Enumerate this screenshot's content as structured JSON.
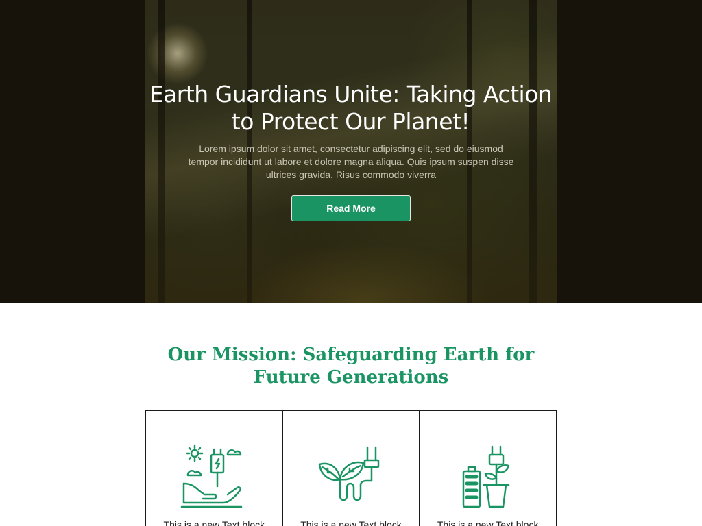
{
  "hero": {
    "title": "Earth Guardians Unite: Taking Action to Protect Our Planet!",
    "text": "Lorem ipsum dolor sit amet, consectetur adipiscing elit, sed do eiusmod tempor incididunt ut labore et dolore magna aliqua. Quis ipsum suspen disse ultrices gravida. Risus commodo viverra",
    "button_label": "Read More"
  },
  "mission": {
    "title": "Our Mission: Safeguarding Earth for Future Generations",
    "cards": [
      {
        "icon": "green-energy-hand-icon",
        "text": "This is a new Text block"
      },
      {
        "icon": "leaf-plug-icon",
        "text": "This is a new Text block"
      },
      {
        "icon": "battery-plant-icon",
        "text": "This is a new Text block"
      }
    ]
  },
  "colors": {
    "accent": "#1a9462",
    "hero_background": "#17130a",
    "text_dark": "#222222"
  }
}
